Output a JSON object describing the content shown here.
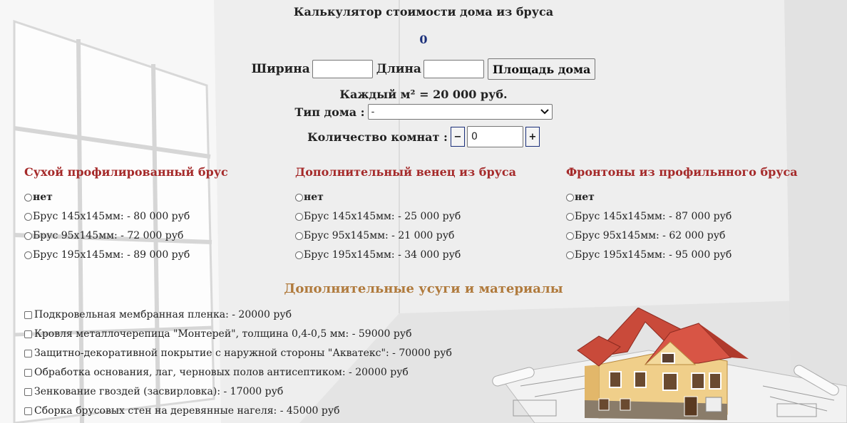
{
  "header": {
    "title": "Калькулятор стоимости дома из бруса",
    "result": "0"
  },
  "dimensions": {
    "width_label": "Ширина",
    "width_value": "",
    "length_label": "Длина",
    "length_value": "",
    "area_button": "Площадь дома"
  },
  "price_per_m2": "Каждый м² = 20 000 руб.",
  "house_type": {
    "label": "Тип дома :",
    "selected": "-"
  },
  "rooms": {
    "label": "Количество комнат :",
    "minus": "−",
    "value": "0",
    "plus": "+"
  },
  "columns": [
    {
      "title": "Сухой профилированный брус",
      "options": [
        "нет",
        "Брус 145х145мм: - 80 000 руб",
        "Брус 95х145мм: - 72 000 руб",
        "Брус 195х145мм: - 89 000 руб"
      ]
    },
    {
      "title": "Дополнительный венец из бруса",
      "options": [
        "нет",
        "Брус 145х145мм: - 25 000 руб",
        "Брус 95х145мм: - 21 000 руб",
        "Брус 195х145мм: - 34 000 руб"
      ]
    },
    {
      "title": "Фронтоны из профильнного бруса",
      "options": [
        "нет",
        "Брус 145х145мм: - 87 000 руб",
        "Брус 95х145мм: - 62 000 руб",
        "Брус 195х145мм: - 95 000 руб"
      ]
    }
  ],
  "extras": {
    "title": "Дополнительные усуги и материалы",
    "items": [
      "Подкровельная мембранная пленка: - 20000 руб",
      "Кровля металлочерепица \"Монтерей\", толщина 0,4-0,5 мм: - 59000 руб",
      "Защитно-декоративной покрытие с наружной стороны \"Акватекс\": - 70000 руб",
      "Обработка основания, лаг, черновых полов антисептиком: - 20000 руб",
      "Зенкование гвоздей (засвирловка): - 17000 руб",
      "Сборка брусовых стен на деревянные нагеля: - 45000 руб"
    ]
  },
  "colors": {
    "section_title": "#a52a2a",
    "extras_title": "#b07a3c",
    "result": "#1a2f7a"
  }
}
